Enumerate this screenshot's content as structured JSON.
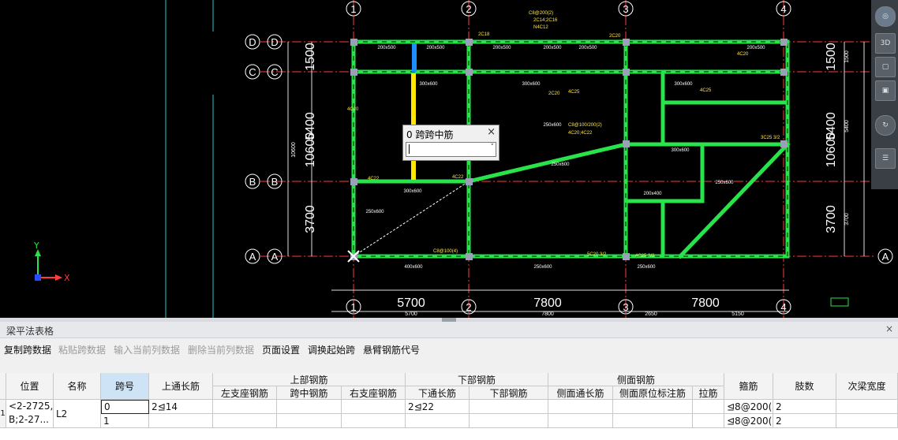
{
  "cad": {
    "axes_top": [
      "1",
      "2",
      "3",
      "4"
    ],
    "axes_bottom": [
      "1",
      "2",
      "3",
      "4"
    ],
    "axes_left": [
      "D",
      "C",
      "B",
      "A"
    ],
    "axes_right": [
      "A"
    ],
    "dims_bottom": [
      "5700",
      "7800",
      "7800"
    ],
    "dims_bottom_small": [
      "5700",
      "7800",
      "2650",
      "5150"
    ],
    "dims_left": [
      "1500",
      "5400",
      "10600",
      "3700"
    ],
    "dims_left_small": [
      "10600"
    ],
    "dims_right": [
      "1500",
      "5400",
      "10600",
      "3700"
    ],
    "dims_right_small": [
      "1500",
      "5400",
      "3700"
    ],
    "dim_top_partial": [
      "5700",
      "7800"
    ],
    "ucs_y": "Y",
    "ucs_x": "X",
    "beam_labels": [
      "200x500",
      "200x500",
      "200x500",
      "200x500",
      "200x500",
      "200x500",
      "300x600",
      "300x600",
      "300x600",
      "300x600",
      "250x600",
      "250x600",
      "200x400",
      "400x600",
      "250x600",
      "250x600",
      "250x600",
      "300x600",
      "250x600"
    ],
    "rebar_labels": [
      "4C20",
      "4C22",
      "4C25",
      "2C18",
      "2C20",
      "4C20",
      "2C20",
      "4C25",
      "4C22",
      "C8@200(2)",
      "2C14;2C16",
      "N4C12",
      "C8@100/200(2)",
      "4C20;4C22",
      "5C20 3/2",
      "4C25 3/2",
      "3C25 3/2",
      "C8@100(4)"
    ],
    "colors": {
      "beam": "#29e34a",
      "grid": "#ff3b3b",
      "dim": "#ffffff",
      "text": "#ffe64a",
      "hilite": "#ffe600",
      "sel": "#1e8fff",
      "wall": "#b0ffb8"
    }
  },
  "toolbar_right": {
    "icons": [
      "orbit-icon",
      "3d-view-icon",
      "cube-front-icon",
      "cube-top-icon",
      "rotate-icon",
      "grid-dots-icon"
    ],
    "labels": [
      "3D",
      "↻",
      "☰"
    ]
  },
  "popup": {
    "title": "0 跨跨中筋",
    "value": "",
    "close": "×",
    "dropdown": "˅"
  },
  "panel": {
    "title": "梁平法表格",
    "close": "×",
    "menu": [
      {
        "label": "复制跨数据",
        "enabled": true
      },
      {
        "label": "粘贴跨数据",
        "enabled": false
      },
      {
        "label": "输入当前列数据",
        "enabled": false
      },
      {
        "label": "删除当前列数据",
        "enabled": false
      },
      {
        "label": "页面设置",
        "enabled": true
      },
      {
        "label": "调换起始跨",
        "enabled": true
      },
      {
        "label": "悬臂钢筋代号",
        "enabled": true
      }
    ]
  },
  "table": {
    "headers_top": {
      "weizhi": "位置",
      "mingcheng": "名称",
      "kuahao": "跨号",
      "shangtong": "上通长筋",
      "shangbu": "上部钢筋",
      "xiabu": "下部钢筋",
      "cemian": "侧面钢筋",
      "gujin": "箍筋",
      "zhishu": "肢数",
      "ciliang": "次梁宽度"
    },
    "headers_sub": {
      "zuozhi": "左支座钢筋",
      "kuazhong": "跨中钢筋",
      "youzhi": "右支座钢筋",
      "xiatong": "下通长筋",
      "xiabugj": "下部钢筋",
      "cemiantong": "侧面通长筋",
      "cemianyuan": "侧面原位标注筋",
      "lajin": "拉筋"
    },
    "rows": [
      {
        "idx": "1",
        "pos": "<2-2725,",
        "pos2": "B;2-27...",
        "name": "L2",
        "span": "0",
        "top_long": "2⊴14",
        "bottom_long": "2⊴22",
        "stirrup": "⊴8@200(",
        "legs": "2"
      },
      {
        "idx": "",
        "pos": "",
        "pos2": "",
        "name": "",
        "span": "1",
        "top_long": "",
        "bottom_long": "",
        "stirrup": "⊴8@200(",
        "legs": "2"
      }
    ]
  }
}
